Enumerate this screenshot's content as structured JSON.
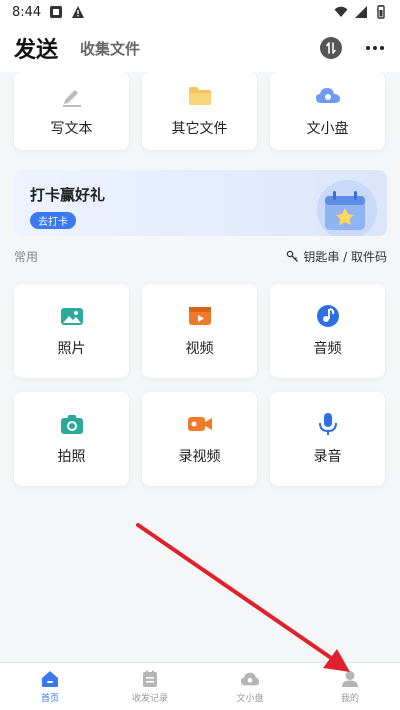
{
  "status_bar": {
    "time": "8:44"
  },
  "header": {
    "title": "发送",
    "subtitle": "收集文件"
  },
  "top_cards": [
    {
      "label": "写文本",
      "icon": "pencil-icon"
    },
    {
      "label": "其它文件",
      "icon": "folder-icon"
    },
    {
      "label": "文小盘",
      "icon": "cloud-disk-icon"
    }
  ],
  "banner": {
    "title": "打卡赢好礼",
    "button": "去打卡",
    "icon": "calendar-star-icon"
  },
  "section": {
    "label": "常用",
    "link": "钥匙串 / 取件码"
  },
  "grid_cards": [
    {
      "label": "照片",
      "icon": "photo-icon"
    },
    {
      "label": "视频",
      "icon": "video-icon"
    },
    {
      "label": "音频",
      "icon": "music-icon"
    },
    {
      "label": "拍照",
      "icon": "camera-icon"
    },
    {
      "label": "录视频",
      "icon": "record-video-icon"
    },
    {
      "label": "录音",
      "icon": "microphone-icon"
    }
  ],
  "bottom_nav": [
    {
      "label": "首页",
      "icon": "home-icon",
      "active": true
    },
    {
      "label": "收发记录",
      "icon": "records-icon",
      "active": false
    },
    {
      "label": "文小盘",
      "icon": "cloud-icon",
      "active": false
    },
    {
      "label": "我的",
      "icon": "profile-icon",
      "active": false
    }
  ],
  "colors": {
    "accent": "#3a79f0",
    "teal": "#2aaa9b",
    "orange": "#f07a2a",
    "annotation_arrow": "#e0212b"
  }
}
